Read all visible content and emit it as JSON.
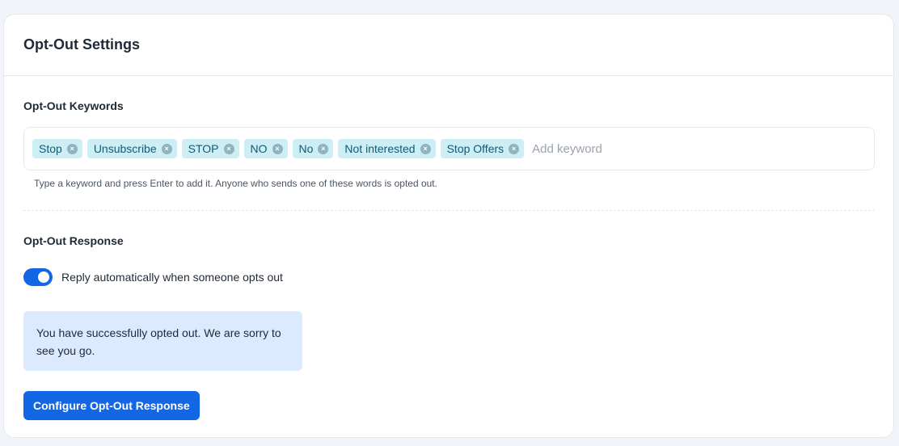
{
  "card": {
    "title": "Opt-Out Settings"
  },
  "keywords": {
    "label": "Opt-Out Keywords",
    "tags": [
      "Stop",
      "Unsubscribe",
      "STOP",
      "NO",
      "No",
      "Not interested",
      "Stop Offers"
    ],
    "remove_glyph": "×",
    "input_placeholder": "Add keyword",
    "input_value": "",
    "help_text": "Type a keyword and press Enter to add it. Anyone who sends one of these words is opted out."
  },
  "response": {
    "label": "Opt-Out Response",
    "toggle_label": "Reply automatically when someone opts out",
    "toggle_on": true,
    "message": "You have successfully opted out. We are sorry to see you go.",
    "button_label": "Configure Opt-Out Response"
  },
  "colors": {
    "accent": "#1366e4",
    "tag_bg": "#cdeef5",
    "message_bg": "#dbeafe"
  }
}
